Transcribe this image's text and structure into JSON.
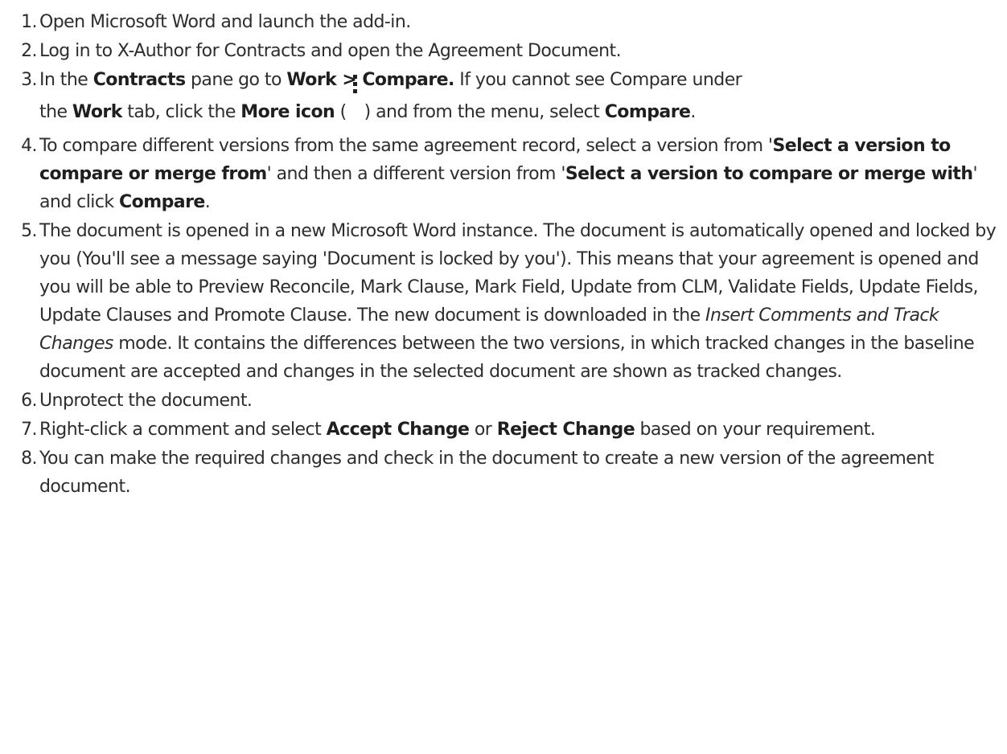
{
  "steps": [
    {
      "num": "1.",
      "text": "Open Microsoft Word and launch the add-in."
    },
    {
      "num": "2.",
      "text": "Log in to X-Author for Contracts and open the Agreement Document."
    },
    {
      "num": "3.",
      "t1": "In the ",
      "b1": "Contracts",
      "t2": " pane go to ",
      "b2": "Work > Compare.",
      "t3": " If you cannot see Compare under",
      "t4": "the ",
      "b3": "Work",
      "t5": " tab, click the ",
      "b4": "More icon",
      "t6": " (",
      "icon": "more-vertical-icon",
      "t7": ") and from the menu, select ",
      "b5": "Compare",
      "t8": "."
    },
    {
      "num": "4.",
      "t1": "To compare different versions from the same agreement record, select a version from '",
      "b1": "Select a version to compare or merge from",
      "t2": "' and then a different version from '",
      "b2": "Select a version to compare or merge with",
      "t3": "' and click ",
      "b3": "Compare",
      "t4": "."
    },
    {
      "num": "5.",
      "t1": "The document is opened in a new Microsoft Word instance. The document is automatically opened and locked by you (You'll see a message saying 'Document is locked by you'). This means that your agreement is opened and you will be able to Preview Reconcile, Mark Clause, Mark Field, Update from CLM, Validate Fields, Update Fields, Update Clauses and Promote Clause. The new document is downloaded in the ",
      "i1": "Insert Comments and Track Changes",
      "t2": " mode. It contains the differences between the two versions, in which tracked changes in the baseline document are accepted and changes in the selected document are shown as tracked changes."
    },
    {
      "num": "6.",
      "text": "Unprotect the document."
    },
    {
      "num": "7.",
      "t1": "Right-click a comment and select ",
      "b1": "Accept Change",
      "t2": " or ",
      "b2": "Reject Change",
      "t3": " based on your requirement."
    },
    {
      "num": "8.",
      "text": "You can make the required changes and check in the document to create a new version of the agreement document."
    }
  ]
}
